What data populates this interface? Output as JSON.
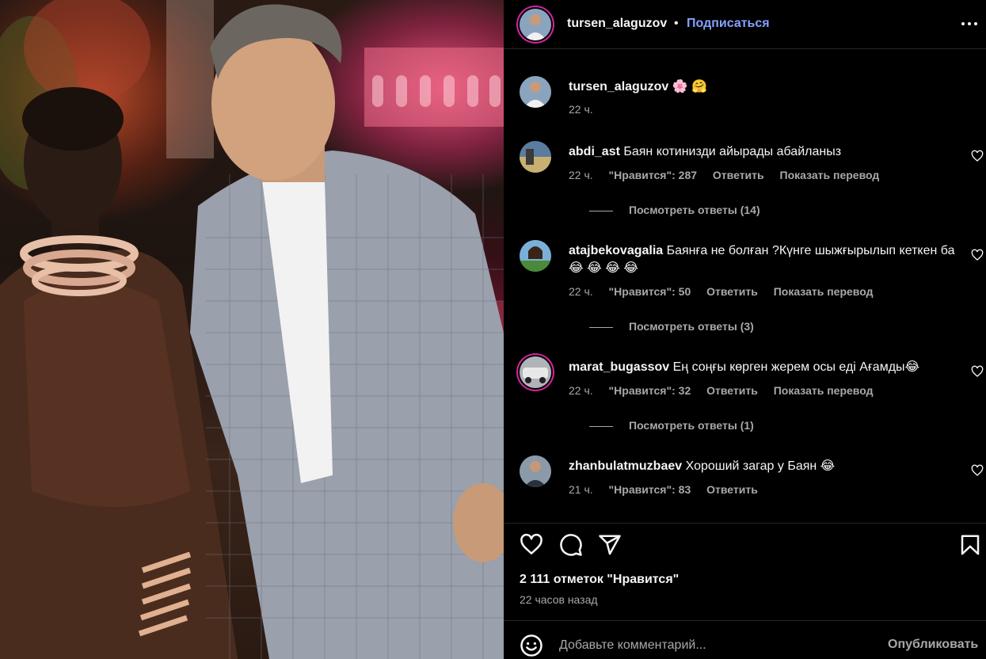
{
  "header": {
    "username": "tursen_alaguzov",
    "separator": "•",
    "follow_label": "Подписаться"
  },
  "caption": {
    "username": "tursen_alaguzov",
    "text": " 🌸 🤗",
    "time": "22 ч."
  },
  "comments": [
    {
      "username": "abdi_ast",
      "text": " Баян котинизди айырады абайланыз",
      "time": "22 ч.",
      "likes": "\"Нравится\": 287",
      "reply": "Ответить",
      "translate": "Показать перевод",
      "replies": "Посмотреть ответы (14)"
    },
    {
      "username": "atajbekovagalia",
      "text": " Баянға не болған ?Күнге шыжғырылып кеткен ба😂 😂 😂 😂",
      "time": "22 ч.",
      "likes": "\"Нравится\": 50",
      "reply": "Ответить",
      "translate": "Показать перевод",
      "replies": "Посмотреть ответы (3)"
    },
    {
      "username": "marat_bugassov",
      "text": " Ең соңғы көрген жерем осы еді Ағамды😂",
      "time": "22 ч.",
      "likes": "\"Нравится\": 32",
      "reply": "Ответить",
      "translate": "Показать перевод",
      "replies": "Посмотреть ответы (1)"
    },
    {
      "username": "zhanbulatmuzbaev",
      "text": " Хороший загар у Баян 😂",
      "time": "21 ч.",
      "likes": "\"Нравится\": 83",
      "reply": "Ответить"
    }
  ],
  "likes_count": "2 111 отметок \"Нравится\"",
  "posted": "22 часов назад",
  "add_comment": {
    "placeholder": "Добавьте комментарий...",
    "publish_label": "Опубликовать"
  },
  "icons": {
    "like": "heart-icon",
    "comment": "comment-icon",
    "share": "share-icon",
    "save": "bookmark-icon",
    "emoji": "emoji-icon",
    "more": "more-options-icon"
  },
  "colors": {
    "background": "#000000",
    "text_primary": "#f5f5f5",
    "text_secondary": "#a8a8a8",
    "link_blue": "#85a1ff",
    "divider": "#262626",
    "story_ring": "#d6249f"
  }
}
